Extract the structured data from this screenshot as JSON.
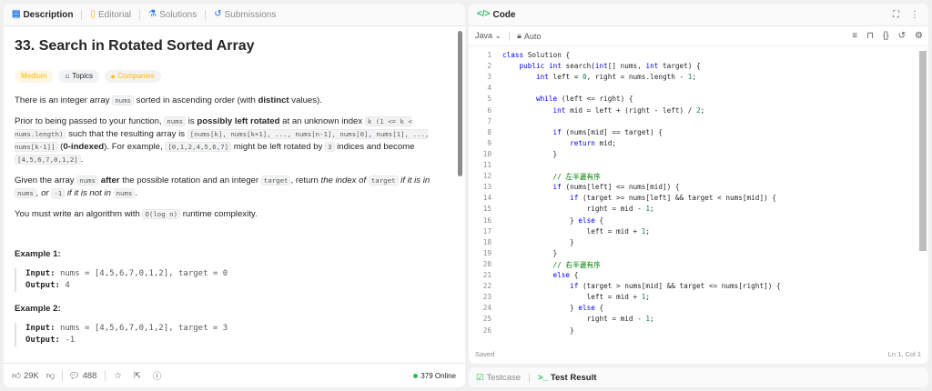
{
  "tabs": {
    "description": "Description",
    "editorial": "Editorial",
    "solutions": "Solutions",
    "submissions": "Submissions"
  },
  "problem": {
    "title": "33. Search in Rotated Sorted Array",
    "difficulty": "Medium",
    "topics": "Topics",
    "companies": "Companies",
    "p1": [
      "There is an integer array ",
      "nums",
      " sorted in ascending order (with ",
      "distinct",
      " values)."
    ],
    "p2": [
      "Prior to being passed to your function, ",
      "nums",
      " is ",
      "possibly left rotated",
      " at an unknown index ",
      "k (1 <= k < nums.length)",
      " such that the resulting array is ",
      "[nums[k], nums[k+1], ..., nums[n-1], nums[0], nums[1], ..., nums[k-1]]",
      " (",
      "0-indexed",
      "). For example, ",
      "[0,1,2,4,5,6,7]",
      " might be left rotated by ",
      "3",
      " indices and become ",
      "[4,5,6,7,0,1,2]",
      "."
    ],
    "p3": [
      "Given the array ",
      "nums",
      " after",
      " the possible rotation and an integer ",
      "target",
      ", return ",
      "the index of ",
      "target",
      " if it is in ",
      "nums",
      ", or ",
      "-1",
      " if it is not in ",
      "nums",
      "."
    ],
    "p4": [
      "You must write an algorithm with ",
      "O(log n)",
      " runtime complexity."
    ],
    "example1_title": "Example 1:",
    "example1_input_label": "Input:",
    "example1_input": "nums = [4,5,6,7,0,1,2], target = 0",
    "example1_output_label": "Output:",
    "example1_output": "4",
    "example2_title": "Example 2:",
    "example2_input_label": "Input:",
    "example2_input": "nums = [4,5,6,7,0,1,2], target = 3",
    "example2_output_label": "Output:",
    "example2_output": "-1"
  },
  "footer": {
    "likes": "29K",
    "comments": "488",
    "online": "379 Online"
  },
  "code_panel": {
    "title": "Code",
    "language": "Java",
    "mode": "Auto",
    "saved": "Saved",
    "cursor": "Ln 1, Col 1"
  },
  "code_lines": [
    "class Solution {",
    "    public int search(int[] nums, int target) {",
    "        int left = 0, right = nums.length - 1;",
    "",
    "        while (left <= right) {",
    "            int mid = left + (right - left) / 2;",
    "",
    "            if (nums[mid] == target) {",
    "                return mid;",
    "            }",
    "",
    "            // 左半邊有序",
    "            if (nums[left] <= nums[mid]) {",
    "                if (target >= nums[left] && target < nums[mid]) {",
    "                    right = mid - 1;",
    "                } else {",
    "                    left = mid + 1;",
    "                }",
    "            }",
    "            // 右半邊有序",
    "            else {",
    "                if (target > nums[mid] && target <= nums[right]) {",
    "                    left = mid + 1;",
    "                } else {",
    "                    right = mid - 1;",
    "                }"
  ],
  "bottom_tabs": {
    "testcase": "Testcase",
    "test_result": "Test Result"
  },
  "colors": {
    "accent": "#ffb800",
    "keyword": "#0000ff",
    "comment": "#008000",
    "online": "#2cbb5d"
  }
}
